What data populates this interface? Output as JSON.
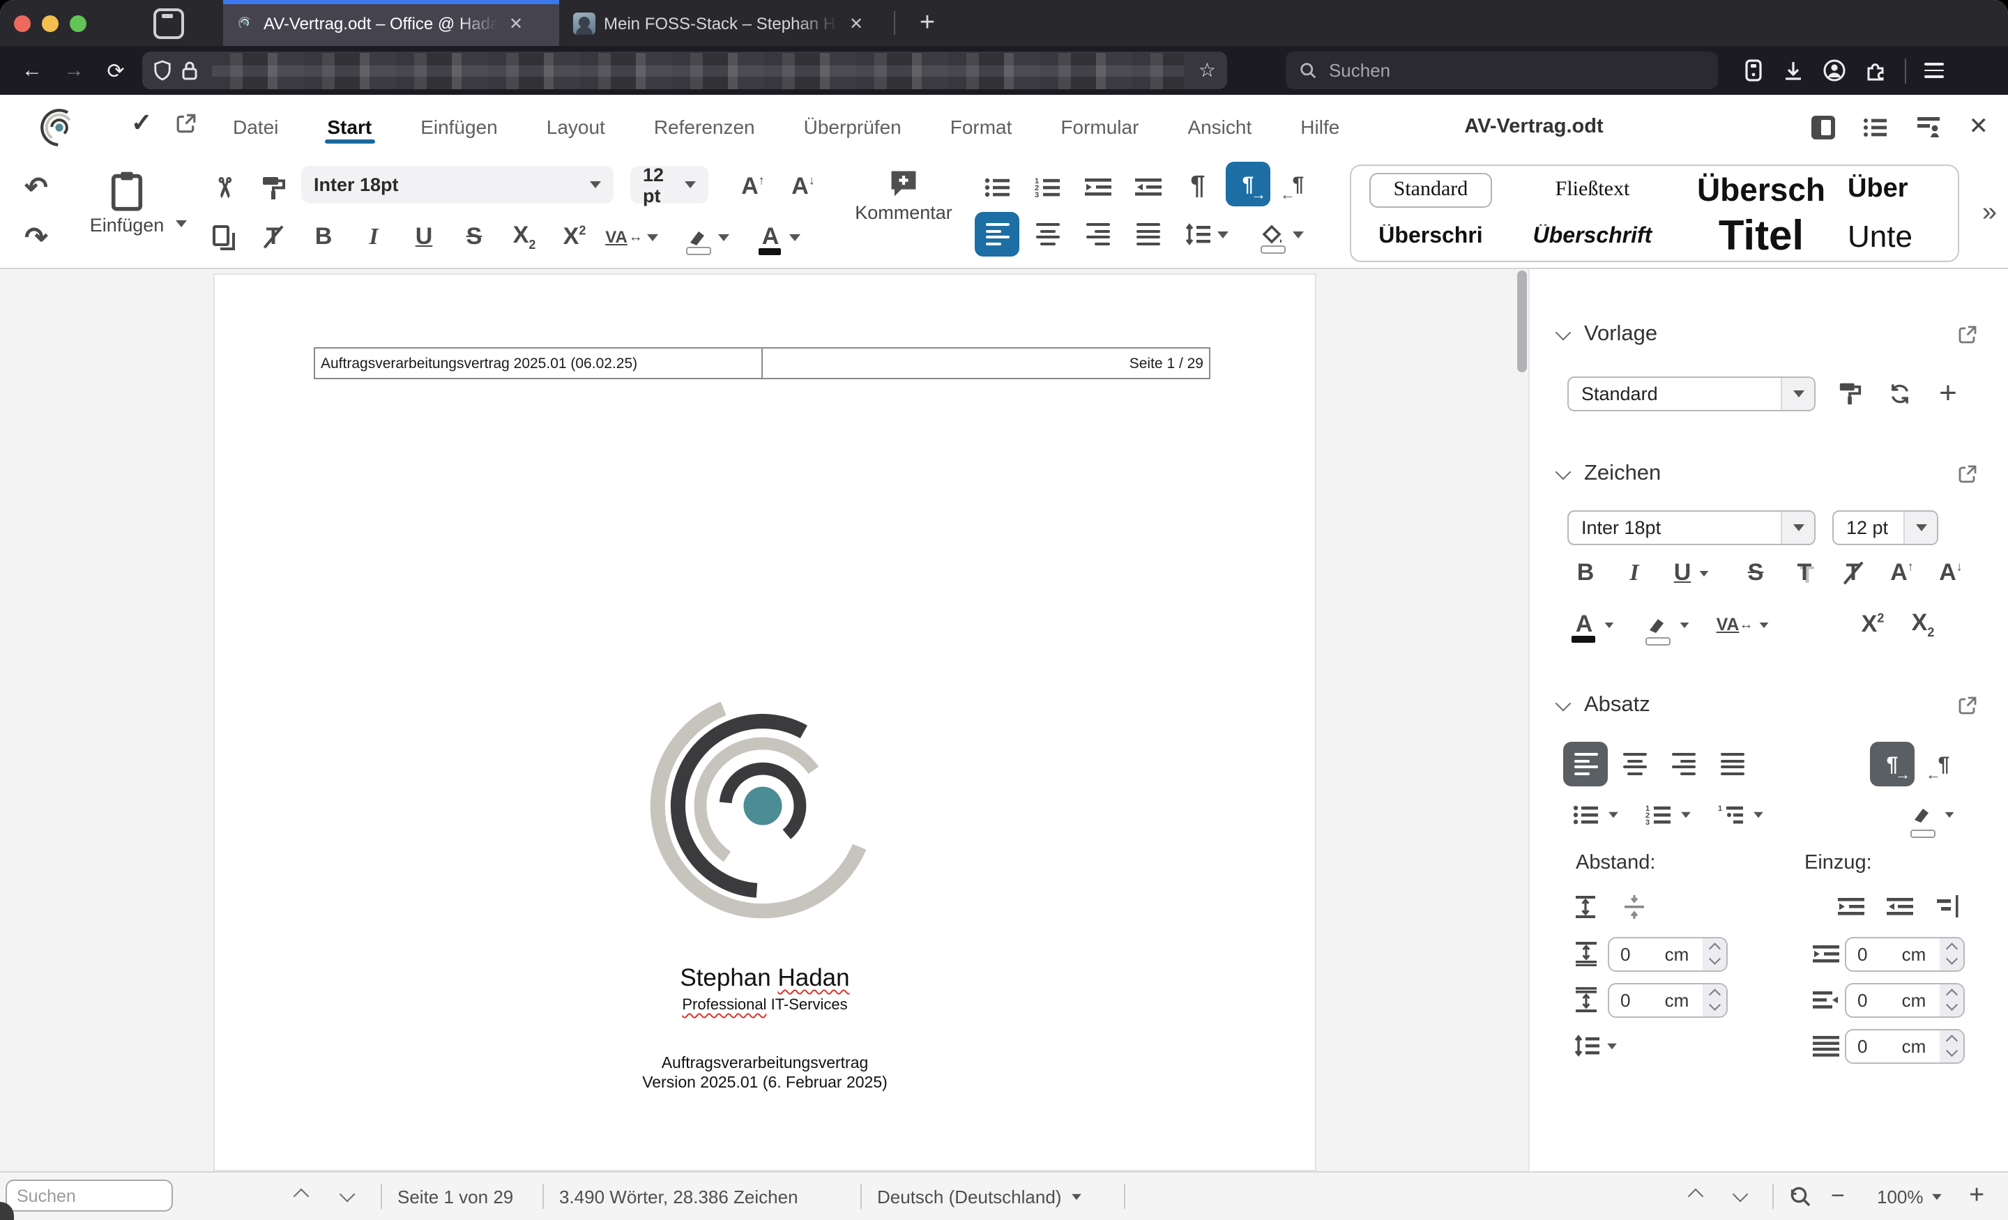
{
  "browser": {
    "tabs": [
      {
        "title": "AV-Vertrag.odt – Office @ Hada"
      },
      {
        "title": "Mein FOSS-Stack – Stephan Ha"
      }
    ],
    "search_placeholder": "Suchen"
  },
  "header": {
    "menu": [
      "Datei",
      "Start",
      "Einfügen",
      "Layout",
      "Referenzen",
      "Überprüfen",
      "Format",
      "Formular",
      "Ansicht",
      "Hilfe"
    ],
    "active_menu": "Start",
    "doc_title": "AV-Vertrag.odt"
  },
  "toolbar": {
    "paste_label": "Einfügen",
    "font_name": "Inter 18pt",
    "font_size": "12 pt",
    "comment_label": "Kommentar",
    "styles": [
      "Standard",
      "Fließtext",
      "Übersch",
      "Über",
      "Überschri",
      "Überschrift",
      "Titel",
      "Unte"
    ]
  },
  "icons": {
    "undo": "↶",
    "redo": "↷",
    "cut": "✂",
    "bold": "B",
    "italic": "I",
    "underline": "U",
    "strike": "S",
    "x": "X",
    "two": "2",
    "spacing": "VA",
    "font_color": "A",
    "grow_a": "A",
    "shrink_a": "A",
    "up": "↑",
    "down": "↓",
    "lr_arrow": "↔",
    "pilcrow": "¶",
    "expander": "»",
    "plus": "+",
    "minus": "−",
    "star": "☆",
    "close": "✕",
    "check": "✓",
    "shadow_t": "T",
    "clear_t": "T",
    "arrow_r": "→",
    "arrow_l": "←"
  },
  "document": {
    "header_left": "Auftragsverarbeitungsvertrag 2025.01 (06.02.25)",
    "header_right": "Seite 1 / 29",
    "name_first": "Stephan ",
    "name_last": "Hadan",
    "tagline_word": "Professional",
    "tagline_rest": " IT-Services",
    "line1": "Auftragsverarbeitungsvertrag",
    "line2": "Version 2025.01 (6. Februar 2025)"
  },
  "sidebar": {
    "vorlage": {
      "title": "Vorlage",
      "value": "Standard"
    },
    "zeichen": {
      "title": "Zeichen",
      "font_name": "Inter 18pt",
      "font_size": "12 pt"
    },
    "absatz": {
      "title": "Absatz",
      "abstand": "Abstand:",
      "einzug": "Einzug:",
      "zero": "0",
      "unit": "cm"
    }
  },
  "status": {
    "search_placeholder": "Suchen",
    "page": "Seite 1 von 29",
    "words": "3.490 Wörter, 28.386 Zeichen",
    "language": "Deutsch (Deutschland)",
    "zoom": "100%"
  },
  "colors": {
    "accent_blue": "#1c6ea4",
    "tab_stripe": "#3b78f0",
    "logo_teal": "#4b8c95",
    "logo_dark": "#3b3b3b",
    "logo_light": "#c6c4bd",
    "squiggle_red": "#d93025"
  }
}
